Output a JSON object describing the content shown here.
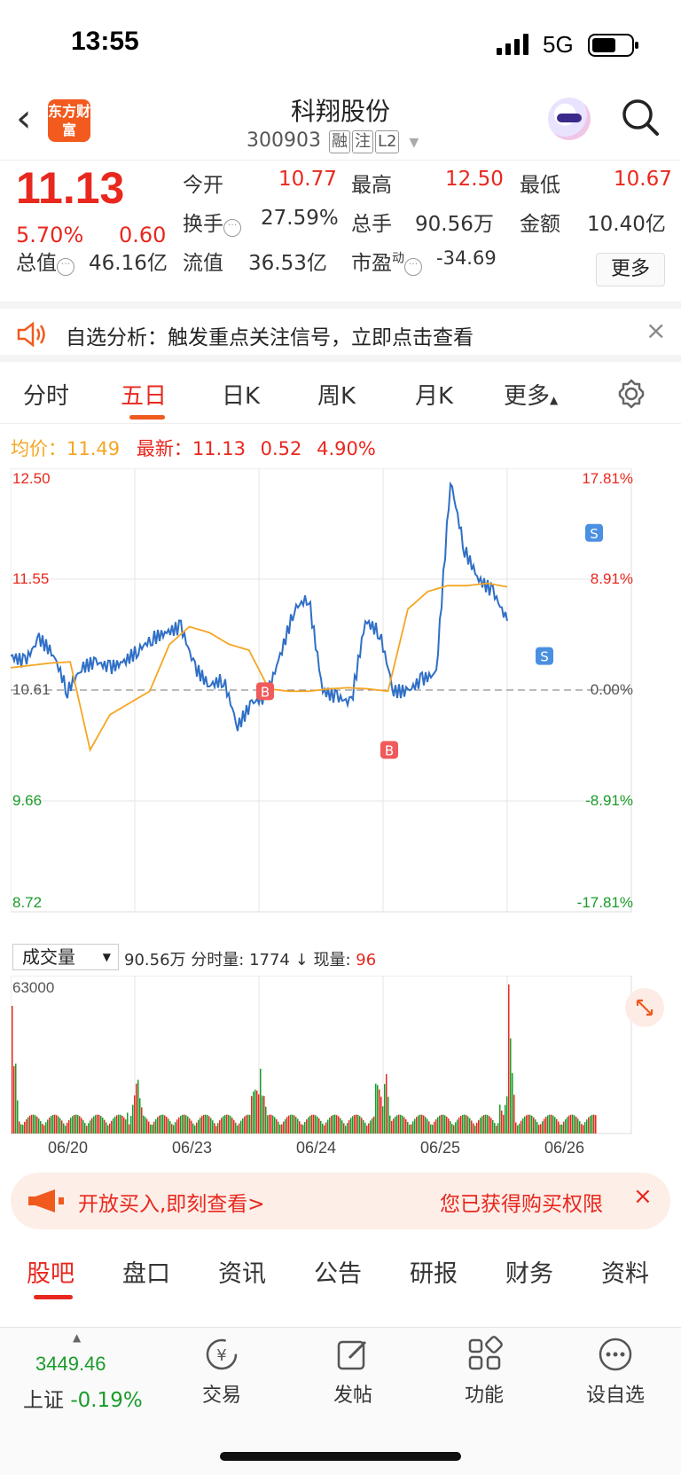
{
  "status_bar": {
    "time": "13:55",
    "network": "5G"
  },
  "header": {
    "logo": "东方财富",
    "stock_name": "科翔股份",
    "stock_code": "300903",
    "tags": [
      "融",
      "注",
      "L2"
    ]
  },
  "quote": {
    "price": "11.13",
    "change_pct": "5.70%",
    "change": "0.60",
    "open_label": "今开",
    "open": "10.77",
    "high_label": "最高",
    "high": "12.50",
    "low_label": "最低",
    "low": "10.67",
    "turnover_label": "换手",
    "turnover": "27.59%",
    "volume_label": "总手",
    "volume": "90.56万",
    "amount_label": "金额",
    "amount": "10.40亿",
    "mktcap_label": "总值",
    "mktcap": "46.16亿",
    "float_label": "流值",
    "float": "36.53亿",
    "pe_label": "市盈",
    "pe_sup": "动",
    "pe": "-34.69",
    "more": "更多"
  },
  "alert": {
    "text": "自选分析：触发重点关注信号，立即点击查看",
    "close": "×"
  },
  "tabs": [
    {
      "label": "分时"
    },
    {
      "label": "五日"
    },
    {
      "label": "日K"
    },
    {
      "label": "周K"
    },
    {
      "label": "月K"
    },
    {
      "label": "更多"
    }
  ],
  "chart_info": {
    "avg_label": "均价：",
    "avg": "11.49",
    "latest_label": "最新：",
    "latest": "11.13",
    "chg": "0.52",
    "pct": "4.90%"
  },
  "chart_data": {
    "type": "line",
    "x": [
      "06/20",
      "06/23",
      "06/24",
      "06/25",
      "06/26"
    ],
    "yticks_left": [
      "12.50",
      "11.55",
      "10.61",
      "9.66",
      "8.72"
    ],
    "yticks_right": [
      "17.81%",
      "8.91%",
      "0.00%",
      "-8.91%",
      "-17.81%"
    ],
    "ylim": [
      8.72,
      12.5
    ],
    "prev_close": 10.61,
    "series": [
      {
        "name": "最新",
        "color": "#2f6fc6",
        "values": [
          10.9,
          10.85,
          11.05,
          10.92,
          10.6,
          10.8,
          10.85,
          10.8,
          10.85,
          10.95,
          11.05,
          11.1,
          11.15,
          10.8,
          10.65,
          10.7,
          10.3,
          10.5,
          10.55,
          10.9,
          11.3,
          11.4,
          10.6,
          10.55,
          10.5,
          11.2,
          11.1,
          10.6,
          10.6,
          10.7,
          10.75,
          12.4,
          11.8,
          11.55,
          11.45,
          11.2
        ]
      },
      {
        "name": "均价",
        "color": "#f5a623",
        "values": [
          10.8,
          10.82,
          10.84,
          10.85,
          10.1,
          10.4,
          10.5,
          10.6,
          11.0,
          11.15,
          11.1,
          11.0,
          10.95,
          10.62,
          10.6,
          10.6,
          10.62,
          10.63,
          10.62,
          10.6,
          11.3,
          11.45,
          11.5,
          11.5,
          11.52,
          11.49
        ]
      }
    ],
    "markers": [
      {
        "label": "B",
        "color": "#f05a5a"
      },
      {
        "label": "B",
        "color": "#f05a5a"
      },
      {
        "label": "S",
        "color": "#4a90e2"
      },
      {
        "label": "S",
        "color": "#4a90e2"
      }
    ]
  },
  "volume": {
    "label": "成交量",
    "total": "90.56万",
    "fen_label": "分时量:",
    "fen": "1774",
    "now_label": "现量:",
    "now": "96",
    "scale": "63000",
    "day_peaks": [
      0.85,
      0.35,
      0.4,
      0.5,
      0.95
    ]
  },
  "banner": {
    "left": "开放买入,即刻查看>",
    "right": "您已获得购买权限",
    "close": "×"
  },
  "bottom_tabs": [
    {
      "label": "股吧"
    },
    {
      "label": "盘口"
    },
    {
      "label": "资讯"
    },
    {
      "label": "公告"
    },
    {
      "label": "研报"
    },
    {
      "label": "财务"
    },
    {
      "label": "资料"
    }
  ],
  "nav": {
    "index_value": "3449.46",
    "index_name": "上证",
    "index_pct": "-0.19%",
    "items": [
      {
        "label": "交易"
      },
      {
        "label": "发帖"
      },
      {
        "label": "功能"
      },
      {
        "label": "设自选"
      }
    ]
  }
}
